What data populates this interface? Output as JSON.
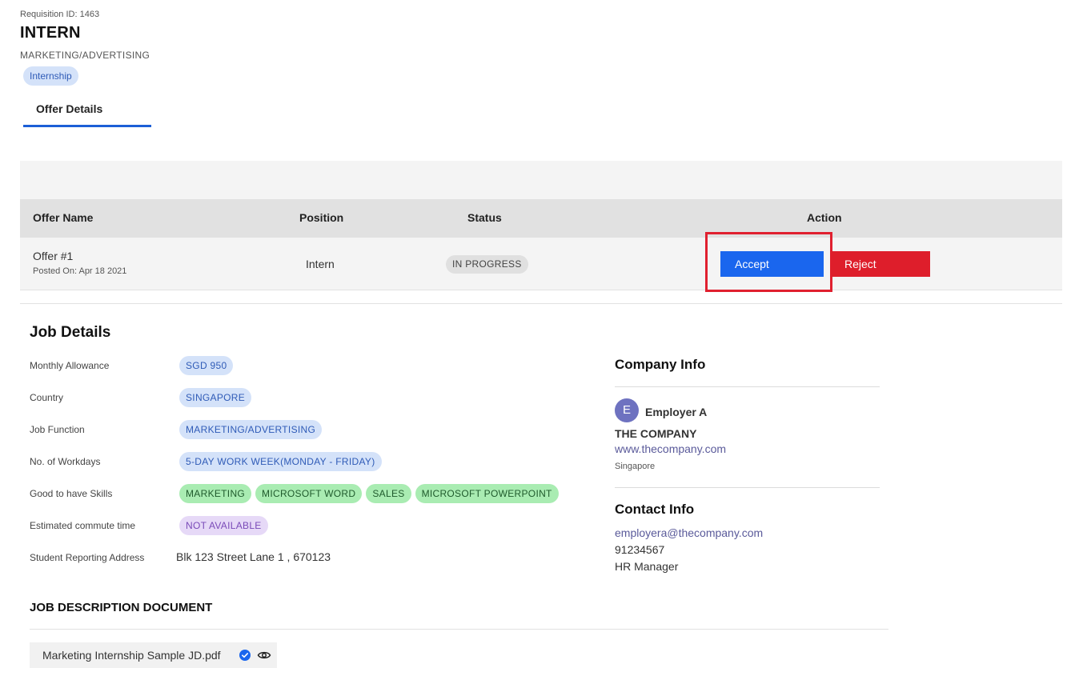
{
  "header": {
    "requisition_id": "Requisition ID: 1463",
    "title": "INTERN",
    "category": "MARKETING/ADVERTISING",
    "type_chip": "Internship"
  },
  "tabs": [
    {
      "label": "Offer Details",
      "active": true
    }
  ],
  "offers_table": {
    "headers": {
      "offer_name": "Offer Name",
      "position": "Position",
      "status": "Status",
      "action": "Action"
    },
    "rows": [
      {
        "offer_name": "Offer #1",
        "posted": "Posted On: Apr 18 2021",
        "position": "Intern",
        "status": "IN PROGRESS",
        "accept_label": "Accept",
        "reject_label": "Reject"
      }
    ]
  },
  "job_details": {
    "title": "Job Details",
    "fields": [
      {
        "label": "Monthly Allowance",
        "chips": [
          "SGD 950"
        ]
      },
      {
        "label": "Country",
        "chips": [
          "SINGAPORE"
        ]
      },
      {
        "label": "Job Function",
        "chips": [
          "MARKETING/ADVERTISING"
        ]
      },
      {
        "label": "No. of Workdays",
        "chips": [
          "5-DAY WORK WEEK(MONDAY - FRIDAY)"
        ]
      },
      {
        "label": "Good to have Skills",
        "chips": [
          "MARKETING",
          "MICROSOFT WORD",
          "SALES",
          "MICROSOFT POWERPOINT"
        ]
      },
      {
        "label": "Estimated commute time",
        "chips": [
          "NOT AVAILABLE"
        ]
      },
      {
        "label": "Student Reporting Address",
        "value": "Blk 123 Street Lane 1 , 670123"
      }
    ]
  },
  "job_description": {
    "title": "JOB DESCRIPTION DOCUMENT",
    "file_name": "Marketing Internship Sample JD.pdf"
  },
  "company_info": {
    "title": "Company Info",
    "avatar_letter": "E",
    "employer_name": "Employer A",
    "company_name": "THE COMPANY",
    "website": "www.thecompany.com",
    "location": "Singapore"
  },
  "contact_info": {
    "title": "Contact Info",
    "email": "employera@thecompany.com",
    "phone": "91234567",
    "role": "HR Manager"
  },
  "colors": {
    "primary": "#1a66ee",
    "danger": "#de1e2b",
    "tab_underline": "#1c5fd6",
    "chip_blue_bg": "#d4e2f9",
    "chip_green_bg": "#a9ecb2",
    "chip_purple_bg": "#e6d9f7"
  },
  "icons": {
    "verified": "check-circle-icon",
    "view": "eye-icon"
  }
}
